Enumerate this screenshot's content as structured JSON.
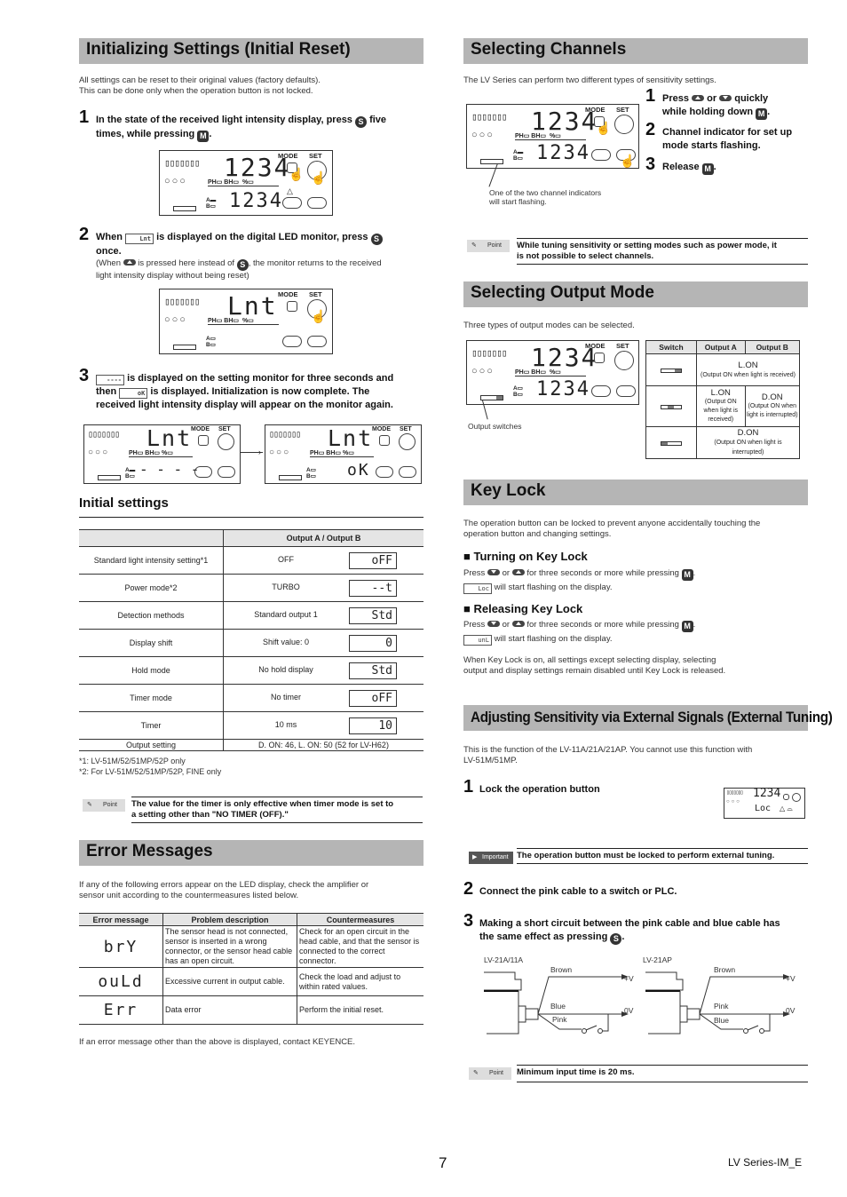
{
  "left": {
    "init": {
      "title": "Initializing Settings (Initial Reset)",
      "intro1": "All settings can be reset to their original values (factory defaults).",
      "intro2": "This can be done only when the operation button is not locked.",
      "step1_num": "1",
      "step1_a": "In the state of the received light intensity display, press",
      "step1_b": "five",
      "step1_c": "times, while pressing",
      "step2_num": "2",
      "step2_a": "When",
      "step2_disp": "Lnt",
      "step2_b": "is displayed on the digital LED monitor, press",
      "step2_c": "once.",
      "step2_note_a": "(When",
      "step2_note_b": "is pressed here instead of",
      "step2_note_c": ", the monitor returns to the received",
      "step2_note_d": "light intensity display without being reset)",
      "step3_num": "3",
      "step3_disp1": "----",
      "step3_a": "is displayed on the setting monitor for three seconds and",
      "step3_b": "then",
      "step3_disp2": "oK",
      "step3_c": "is displayed. Initialization is now complete. The",
      "step3_d": "received light intensity display will appear on the monitor again."
    },
    "panels": {
      "mode": "MODE",
      "set": "SET",
      "ph": "PH",
      "bh": "BH",
      "pct": "%",
      "a": "A",
      "b": "B",
      "bars": "▯▯▯▯▯▯▯",
      "circles": "○○○",
      "p1_top": "1234",
      "p1_bot": "1234",
      "p2_top": "Lnt",
      "p3_top": "Lnt",
      "p3_bot": "- - - -",
      "p4_top": "Lnt",
      "p4_bot": "oK",
      "S": "S",
      "M": "M"
    },
    "initial": {
      "title": "Initial settings",
      "header": "Output A / Output B",
      "rows": [
        {
          "name": "Standard light intensity setting*1",
          "value": "OFF",
          "disp": "oFF"
        },
        {
          "name": "Power mode*2",
          "value": "TURBO",
          "disp": "--t"
        },
        {
          "name": "Detection methods",
          "value": "Standard output 1",
          "disp": "Std"
        },
        {
          "name": "Display shift",
          "value": "Shift value: 0",
          "disp": "0"
        },
        {
          "name": "Hold mode",
          "value": "No hold display",
          "disp": "Std"
        },
        {
          "name": "Timer mode",
          "value": "No timer",
          "disp": "oFF"
        },
        {
          "name": "Timer",
          "value": "10 ms",
          "disp": "10"
        }
      ],
      "last_name": "Output setting",
      "last_value": "D. ON: 46, L. ON: 50 (52 for LV-H62)",
      "foot1": "*1: LV-51M/52/51MP/52P only",
      "foot2": "*2: For LV-51M/52/51MP/52P, FINE only",
      "point_label": "Point",
      "point_text1": "The value for the timer is only effective when timer mode is set to",
      "point_text2": "a setting other than \"NO TIMER (OFF).\""
    },
    "errors": {
      "title": "Error Messages",
      "intro1": "If any of the following errors appear on the LED display, check the amplifier or",
      "intro2": "sensor unit according to the countermeasures listed below.",
      "headers": [
        "Error message",
        "Problem description",
        "Countermeasures"
      ],
      "rows": [
        {
          "code": "brY",
          "problem": "The sensor head is not connected, sensor is inserted in a wrong connector, or the sensor head cable has an open circuit.",
          "fix": "Check for an open circuit in the head cable, and that the sensor is connected to the correct connector."
        },
        {
          "code": "ouLd",
          "problem": "Excessive current in output cable.",
          "fix": "Check the load and adjust to within rated values."
        },
        {
          "code": "Err",
          "problem": "Data error",
          "fix": "Perform the initial reset."
        }
      ],
      "footer": "If an error message other than the above is displayed, contact KEYENCE."
    }
  },
  "right": {
    "channels": {
      "title": "Selecting Channels",
      "intro": "The LV Series can perform two different types of sensitivity settings.",
      "step1_a": "Press",
      "step1_b": "or",
      "step1_c": "quickly",
      "step1_d": "while holding down",
      "step2": "Channel indicator for set up mode starts flashing.",
      "step3": "Release",
      "caption1": "One of the two channel indicators",
      "caption2": "will start flashing.",
      "point_label": "Point",
      "point_text1": "While tuning sensitivity or setting modes such as power mode, it",
      "point_text2": "is not possible to select channels."
    },
    "output": {
      "title": "Selecting Output Mode",
      "intro": "Three types of output modes can be selected.",
      "caption": "Output switches",
      "headers": [
        "Switch",
        "Output A",
        "Output B"
      ],
      "row1_mode": "L.ON",
      "row1_desc": "(Output ON when light is received)",
      "row2a_mode": "L.ON",
      "row2a_desc": "(Output ON when light is received)",
      "row2b_mode": "D.ON",
      "row2b_desc": "(Output ON when light is interrupted)",
      "row3_mode": "D.ON",
      "row3_desc": "(Output ON when light is interrupted)"
    },
    "keylock": {
      "title": "Key Lock",
      "intro1": "The operation button can be locked to prevent anyone accidentally touching the",
      "intro2": "operation button and changing settings.",
      "on_title": "■ Turning on Key Lock",
      "on_a": "Press",
      "on_b": "or",
      "on_c": "for three seconds or more while pressing",
      "on_disp": "Loc",
      "on_d": "will start flashing on the display.",
      "off_title": "■ Releasing Key Lock",
      "off_a": "Press",
      "off_b": "or",
      "off_c": "for three seconds or more while pressing",
      "off_disp": "unL",
      "off_d": "will start flashing on the display.",
      "note1": "When Key Lock is on, all settings except selecting display, selecting",
      "note2": "output and display settings remain disabled until Key Lock is released."
    },
    "external": {
      "title": "Adjusting Sensitivity via External Signals (External Tuning)",
      "intro1": "This is the function of the LV-11A/21A/21AP. You cannot use this function with",
      "intro2": "LV-51M/51MP.",
      "step1": "Lock the operation button",
      "mini_top": "1234",
      "mini_bot": "Loc",
      "imp_label": "Important",
      "imp_text": "The operation button must be locked to perform external tuning.",
      "step2": "Connect the pink cable to a switch or PLC.",
      "step3_a": "Making a short circuit between the pink cable and blue cable has",
      "step3_b": "the same effect as pressing",
      "d1_title": "LV-21A/11A",
      "d1_w1": "Brown",
      "d1_w2": "Blue",
      "d1_w3": "Pink",
      "d2_title": "LV-21AP",
      "d2_w1": "Brown",
      "d2_w2": "Pink",
      "d2_w3": "Blue",
      "plus_v": "+V",
      "zero_v": "0V",
      "point_label": "Point",
      "point_text": "Minimum input time is 20 ms."
    }
  },
  "footer": {
    "page": "7",
    "doc": "LV Series-IM_E"
  }
}
